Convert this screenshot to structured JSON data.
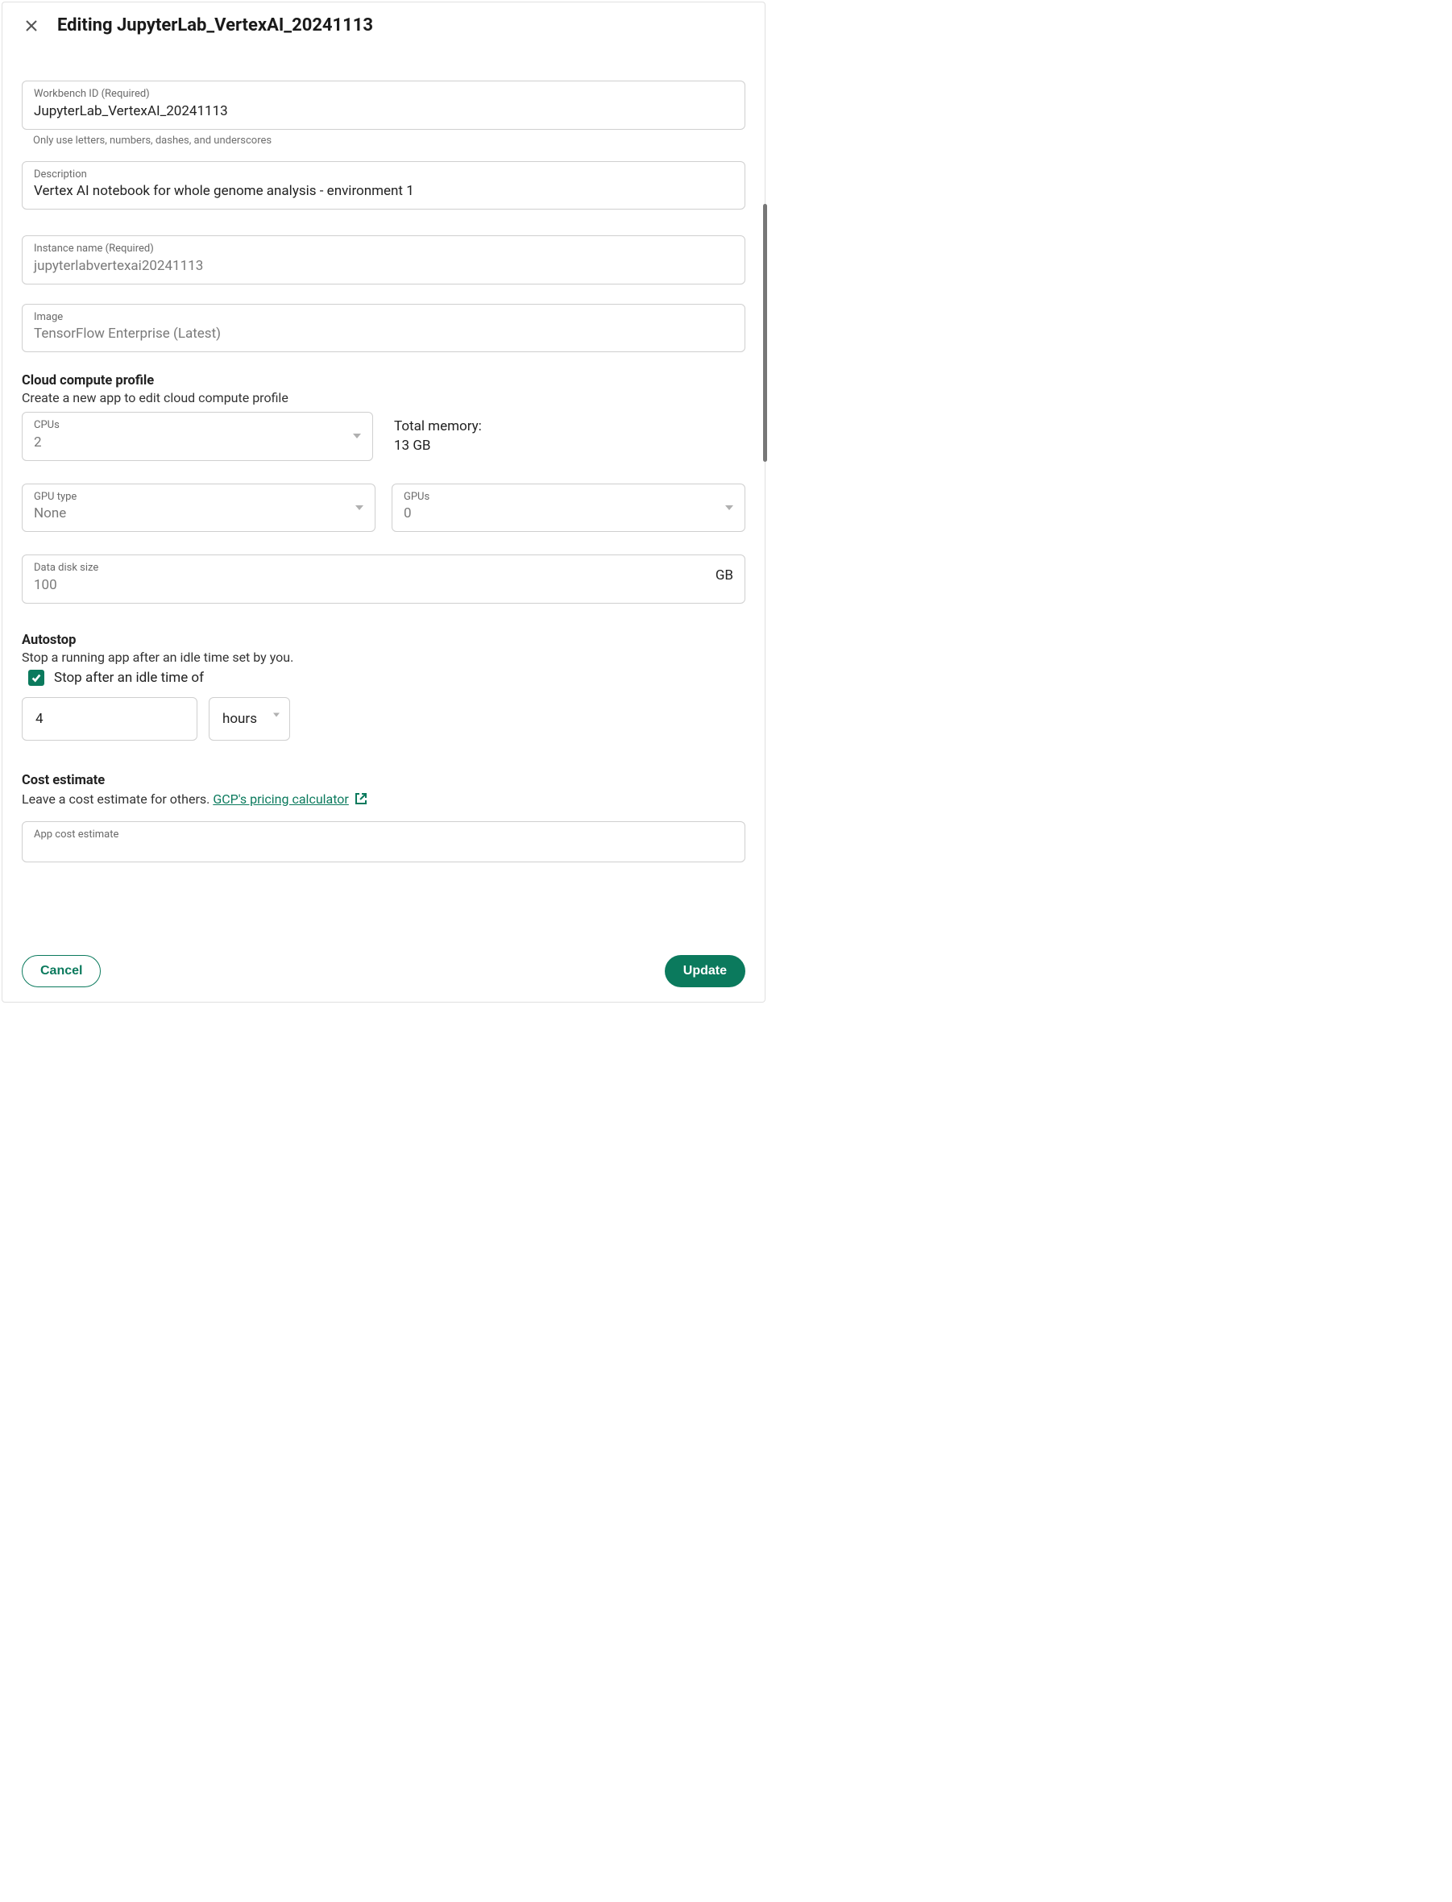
{
  "header": {
    "title": "Editing JupyterLab_VertexAI_20241113"
  },
  "fields": {
    "workbench_id": {
      "label": "Workbench ID (Required)",
      "value": "JupyterLab_VertexAI_20241113",
      "helper": "Only use letters, numbers, dashes, and underscores"
    },
    "description": {
      "label": "Description",
      "value": "Vertex AI notebook for whole genome analysis - environment 1"
    },
    "instance_name": {
      "label": "Instance name (Required)",
      "value": "jupyterlabvertexai20241113"
    },
    "image": {
      "label": "Image",
      "value": "TensorFlow Enterprise (Latest)"
    }
  },
  "compute": {
    "heading": "Cloud compute profile",
    "sub": "Create a new app to edit cloud compute profile",
    "cpus": {
      "label": "CPUs",
      "value": "2"
    },
    "memory": {
      "label": "Total memory:",
      "value": "13 GB"
    },
    "gpu_type": {
      "label": "GPU type",
      "value": "None"
    },
    "gpus": {
      "label": "GPUs",
      "value": "0"
    },
    "disk": {
      "label": "Data disk size",
      "value": "100",
      "unit": "GB"
    }
  },
  "autostop": {
    "heading": "Autostop",
    "sub": "Stop a running app after an idle time set by you.",
    "checkbox_label": "Stop after an idle time of",
    "checked": true,
    "value": "4",
    "unit": "hours"
  },
  "cost": {
    "heading": "Cost estimate",
    "prefix": "Leave a cost estimate for others. ",
    "link_text": "GCP's pricing calculator",
    "field_label": "App cost estimate",
    "field_value": ""
  },
  "footer": {
    "cancel": "Cancel",
    "update": "Update"
  }
}
